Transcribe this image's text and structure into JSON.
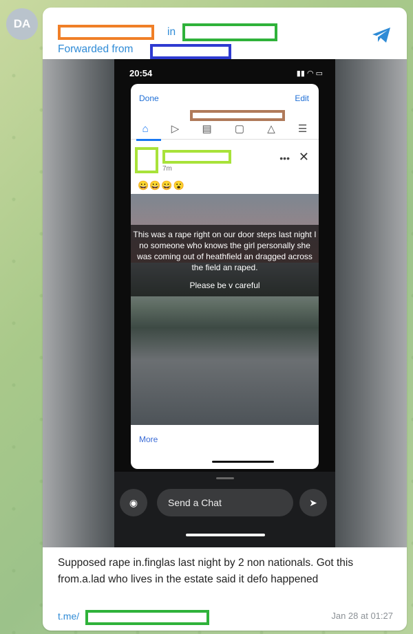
{
  "avatar": {
    "initials": "DA"
  },
  "header": {
    "in_label": "in",
    "forwarded_label": "Forwarded from"
  },
  "phone": {
    "status_time": "20:54",
    "done_label": "Done",
    "edit_label": "Edit",
    "post": {
      "time_label": "7m",
      "emoji": "😀😀😀😮"
    },
    "caption_text": "This was a rape right on our door steps last night I no someone who knows the girl personally she was coming out of heathfield an dragged across the field an raped.",
    "caption_careful": "Please be v careful",
    "more_label": "More",
    "chat_placeholder": "Send a Chat"
  },
  "message": {
    "text": "Supposed rape in.finglas last night by 2 non nationals. Got this from.a.lad who lives in the estate said it defo happened",
    "link_prefix": "t.me/",
    "timestamp": "Jan 28 at 01:27"
  },
  "colors": {
    "accent": "#2f8bd6",
    "redact_orange": "#f07f27",
    "redact_green": "#2fb23a",
    "redact_blue": "#2e3ad1",
    "redact_brown": "#b07a5a",
    "redact_lime": "#a8e23a"
  }
}
